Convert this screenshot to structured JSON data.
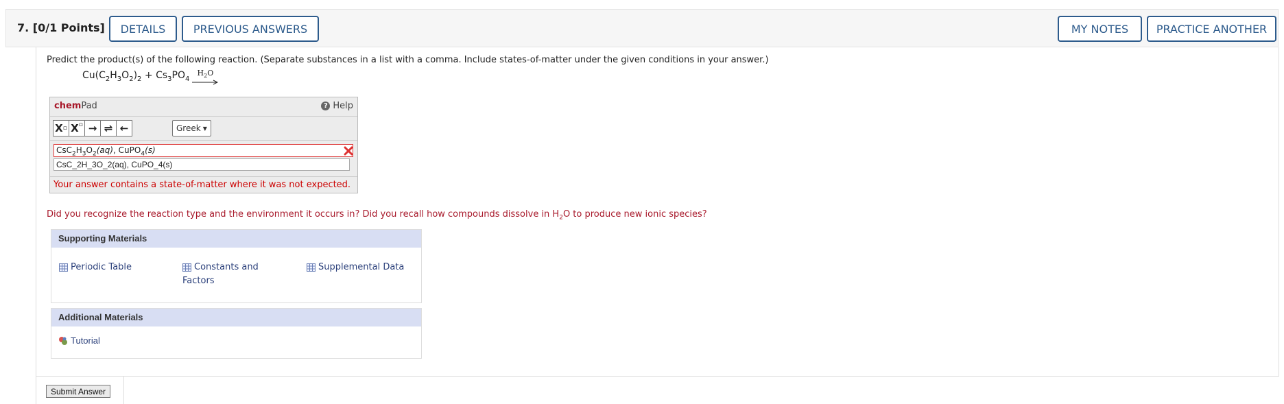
{
  "header": {
    "question_number": "7.",
    "points": "[0/1 Points]",
    "details_label": "DETAILS",
    "previous_answers_label": "PREVIOUS ANSWERS",
    "my_notes_label": "MY NOTES",
    "practice_another_label": "PRACTICE ANOTHER",
    "accent_color": "#2d5b8c"
  },
  "question": {
    "prompt": "Predict the product(s) of the following reaction. (Separate substances in a list with a comma. Include states-of-matter under the given conditions in your answer.)",
    "equation": {
      "reactant1_a": "Cu(C",
      "reactant1_b": "2",
      "reactant1_c": "H",
      "reactant1_d": "3",
      "reactant1_e": "O",
      "reactant1_f": "2",
      "reactant1_g": ")",
      "reactant1_h": "2",
      "plus": " + ",
      "reactant2_a": "Cs",
      "reactant2_b": "3",
      "reactant2_c": "PO",
      "reactant2_d": "4",
      "arrow_label_a": "H",
      "arrow_label_b": "2",
      "arrow_label_c": "O"
    }
  },
  "chempad": {
    "brand": "chem",
    "title_rest": "Pad",
    "help_label": "Help",
    "toolbar": {
      "subscript": "X",
      "superscript": "X",
      "arrow_right": "→",
      "arrow_equilibrium": "⇌",
      "arrow_left": "←",
      "greek_label": "Greek"
    },
    "answer_formatted": {
      "p1": "CsC",
      "p2": "2",
      "p3": "H",
      "p4": "3",
      "p5": "O",
      "p6": "2",
      "p7": "(aq)",
      "p8": ", CuPO",
      "p9": "4",
      "p10": "(s)"
    },
    "answer_raw": "CsC_2H_3O_2(aq), CuPO_4(s)",
    "error_message": "Your answer contains a state-of-matter where it was not expected.",
    "error_color": "#cc0000"
  },
  "feedback": {
    "part1": "Did you recognize the reaction type and the environment it occurs in? Did you recall how compounds dissolve in H",
    "sub": "2",
    "part2": "O to produce new ionic species?",
    "color": "#a8182a"
  },
  "supporting_materials": {
    "title": "Supporting Materials",
    "links": [
      {
        "label": "Periodic Table",
        "icon": "table-icon"
      },
      {
        "label": "Constants and",
        "label2": "Factors",
        "icon": "table-icon"
      },
      {
        "label": "Supplemental Data",
        "icon": "table-icon"
      }
    ]
  },
  "additional_materials": {
    "title": "Additional Materials",
    "links": [
      {
        "label": "Tutorial",
        "icon": "tutorial-icon"
      }
    ]
  },
  "submit": {
    "label": "Submit Answer"
  }
}
